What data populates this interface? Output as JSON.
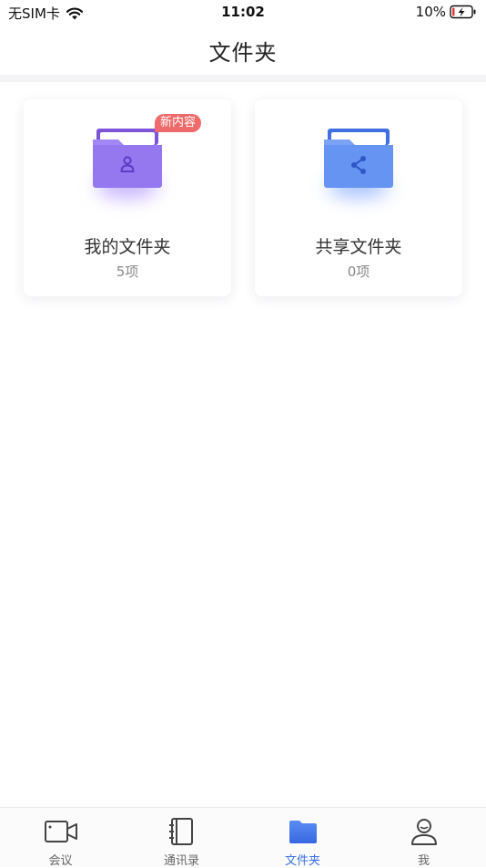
{
  "status_bar": {
    "carrier": "无SIM卡",
    "time": "11:02",
    "battery": "10%"
  },
  "nav": {
    "title": "文件夹"
  },
  "folders": [
    {
      "name": "我的文件夹",
      "count": "5项",
      "badge": "新内容"
    },
    {
      "name": "共享文件夹",
      "count": "0项"
    }
  ],
  "tabs": [
    {
      "label": "会议",
      "icon": "video-camera-icon"
    },
    {
      "label": "通讯录",
      "icon": "contacts-book-icon"
    },
    {
      "label": "文件夹",
      "icon": "folder-icon",
      "active": true
    },
    {
      "label": "我",
      "icon": "user-icon"
    }
  ],
  "colors": {
    "accent": "#3b6fe0",
    "badge": "#ef6b6b",
    "my_folder": "#9a74f2",
    "shared_folder": "#5a8cf0"
  }
}
